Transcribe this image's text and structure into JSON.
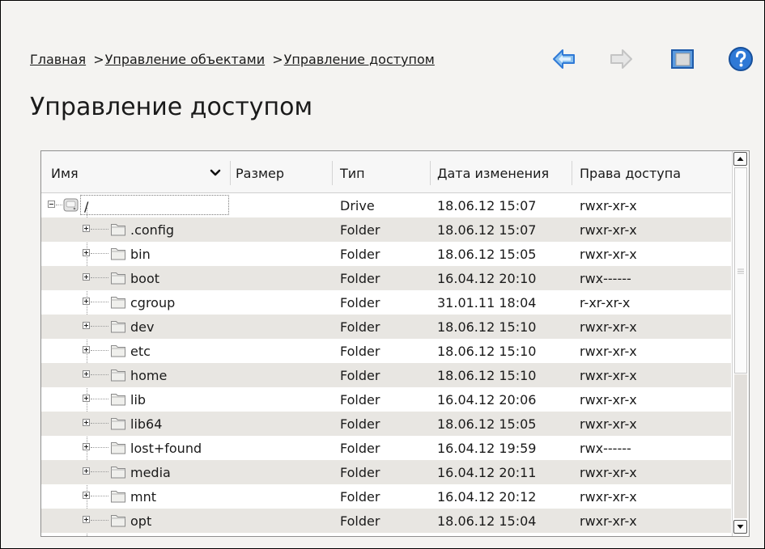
{
  "breadcrumb": [
    {
      "label": "Главная",
      "sep": ">"
    },
    {
      "label": "Управление объектами",
      "sep": ">"
    },
    {
      "label": "Управление доступом",
      "sep": ""
    }
  ],
  "toolbar": {
    "icons": [
      "back-arrow-icon",
      "forward-arrow-icon",
      "panel-icon",
      "help-icon"
    ],
    "colors": {
      "accent_blue": "#2f79d6",
      "forward_gray": "#c4c4c4",
      "help_blue": "#1f64c8"
    }
  },
  "page": {
    "title": "Управление доступом"
  },
  "table": {
    "columns": {
      "name": "Имя",
      "size": "Размер",
      "type": "Тип",
      "date": "Дата изменения",
      "perms": "Права доступа"
    },
    "root": {
      "name": "/",
      "type": "Drive",
      "date": "18.06.12 15:07",
      "perms": "rwxr-xr-x"
    },
    "rows": [
      {
        "name": ".config",
        "type": "Folder",
        "date": "18.06.12 15:07",
        "perms": "rwxr-xr-x"
      },
      {
        "name": "bin",
        "type": "Folder",
        "date": "18.06.12 15:05",
        "perms": "rwxr-xr-x"
      },
      {
        "name": "boot",
        "type": "Folder",
        "date": "16.04.12 20:10",
        "perms": "rwx------"
      },
      {
        "name": "cgroup",
        "type": "Folder",
        "date": "31.01.11 18:04",
        "perms": "r-xr-xr-x"
      },
      {
        "name": "dev",
        "type": "Folder",
        "date": "18.06.12 15:10",
        "perms": "rwxr-xr-x"
      },
      {
        "name": "etc",
        "type": "Folder",
        "date": "18.06.12 15:10",
        "perms": "rwxr-xr-x"
      },
      {
        "name": "home",
        "type": "Folder",
        "date": "18.06.12 15:10",
        "perms": "rwxr-xr-x"
      },
      {
        "name": "lib",
        "type": "Folder",
        "date": "16.04.12 20:06",
        "perms": "rwxr-xr-x"
      },
      {
        "name": "lib64",
        "type": "Folder",
        "date": "18.06.12 15:05",
        "perms": "rwxr-xr-x"
      },
      {
        "name": "lost+found",
        "type": "Folder",
        "date": "16.04.12 19:59",
        "perms": "rwx------"
      },
      {
        "name": "media",
        "type": "Folder",
        "date": "16.04.12 20:11",
        "perms": "rwxr-xr-x"
      },
      {
        "name": "mnt",
        "type": "Folder",
        "date": "16.04.12 20:12",
        "perms": "rwxr-xr-x"
      },
      {
        "name": "opt",
        "type": "Folder",
        "date": "18.06.12 15:04",
        "perms": "rwxr-xr-x"
      }
    ],
    "row_alt_color": "#e8e6e2"
  }
}
